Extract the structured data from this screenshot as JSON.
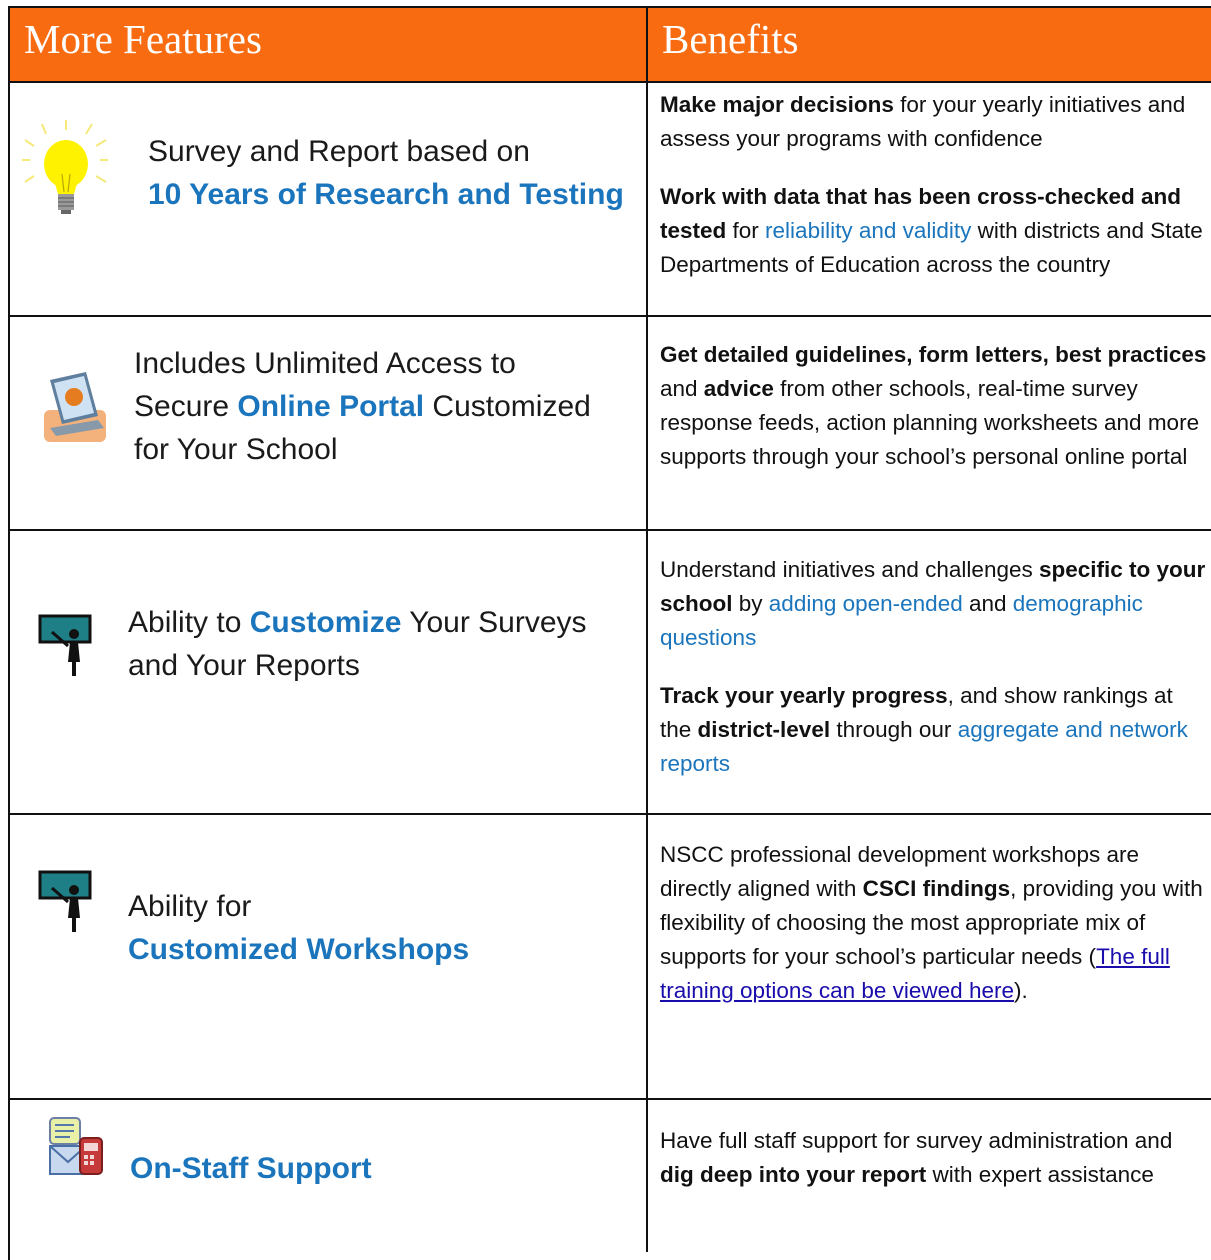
{
  "header": {
    "features_title": "More Features",
    "benefits_title": "Benefits",
    "header_color": "#f96b10"
  },
  "accent_blue": "#1b75bc",
  "rows": [
    {
      "icon": "lightbulb-icon",
      "feature_plain": "Survey and Report based on",
      "feature_highlight": "10 Years of Research  and Testing",
      "b1_bold": "Make major decisions",
      "b1_rest": " for your yearly initiatives and assess your programs with confidence",
      "b2_bold": "Work with data that has been cross-checked and tested",
      "b2_mid": " for ",
      "b2_blue": "reliability and validity",
      "b2_rest": " with districts and State Departments of Education across the country"
    },
    {
      "icon": "laptop-icon",
      "feature_a": "Includes Unlimited Access to",
      "feature_b": "Secure ",
      "feature_highlight": "Online Portal",
      "feature_c": " Customized",
      "feature_d": "for Your School",
      "b1_bold1": "Get detailed guidelines, form letters, best practices",
      "b1_and": " and ",
      "b1_bold2": "advice",
      "b1_rest": " from other schools, real-time survey response feeds, action planning worksheets and more supports through your school’s personal online portal"
    },
    {
      "icon": "presenter-board-icon",
      "feature_a": "Ability to ",
      "feature_highlight": "Customize",
      "feature_b": " Your Surveys",
      "feature_c": "and Your Reports",
      "b1_a": "Understand initiatives and challenges ",
      "b1_bold": "specific to your school",
      "b1_b": " by ",
      "b1_blue1": "adding open-ended",
      "b1_c": " and ",
      "b1_blue2": "demographic questions",
      "b2_bold1": "Track your yearly progress",
      "b2_a": ", and show rankings at the ",
      "b2_bold2": "district-level",
      "b2_b": " through our ",
      "b2_blue": "aggregate and network reports"
    },
    {
      "icon": "presenter-board-icon",
      "feature_a": "Ability for",
      "feature_highlight": "Customized Workshops",
      "b1_a": "NSCC professional development workshops are directly aligned with ",
      "b1_bold": "CSCI findings",
      "b1_b": ", providing you with flexibility of choosing the most appropriate mix of supports for your school’s particular needs (",
      "b1_link": "The full training options can be viewed here",
      "b1_c": ")."
    },
    {
      "icon": "envelope-phone-icon",
      "feature_highlight": "On-Staff Support",
      "b1_a": "Have full staff support for survey administration and ",
      "b1_bold": "dig deep into your report",
      "b1_b": " with expert assistance"
    }
  ]
}
